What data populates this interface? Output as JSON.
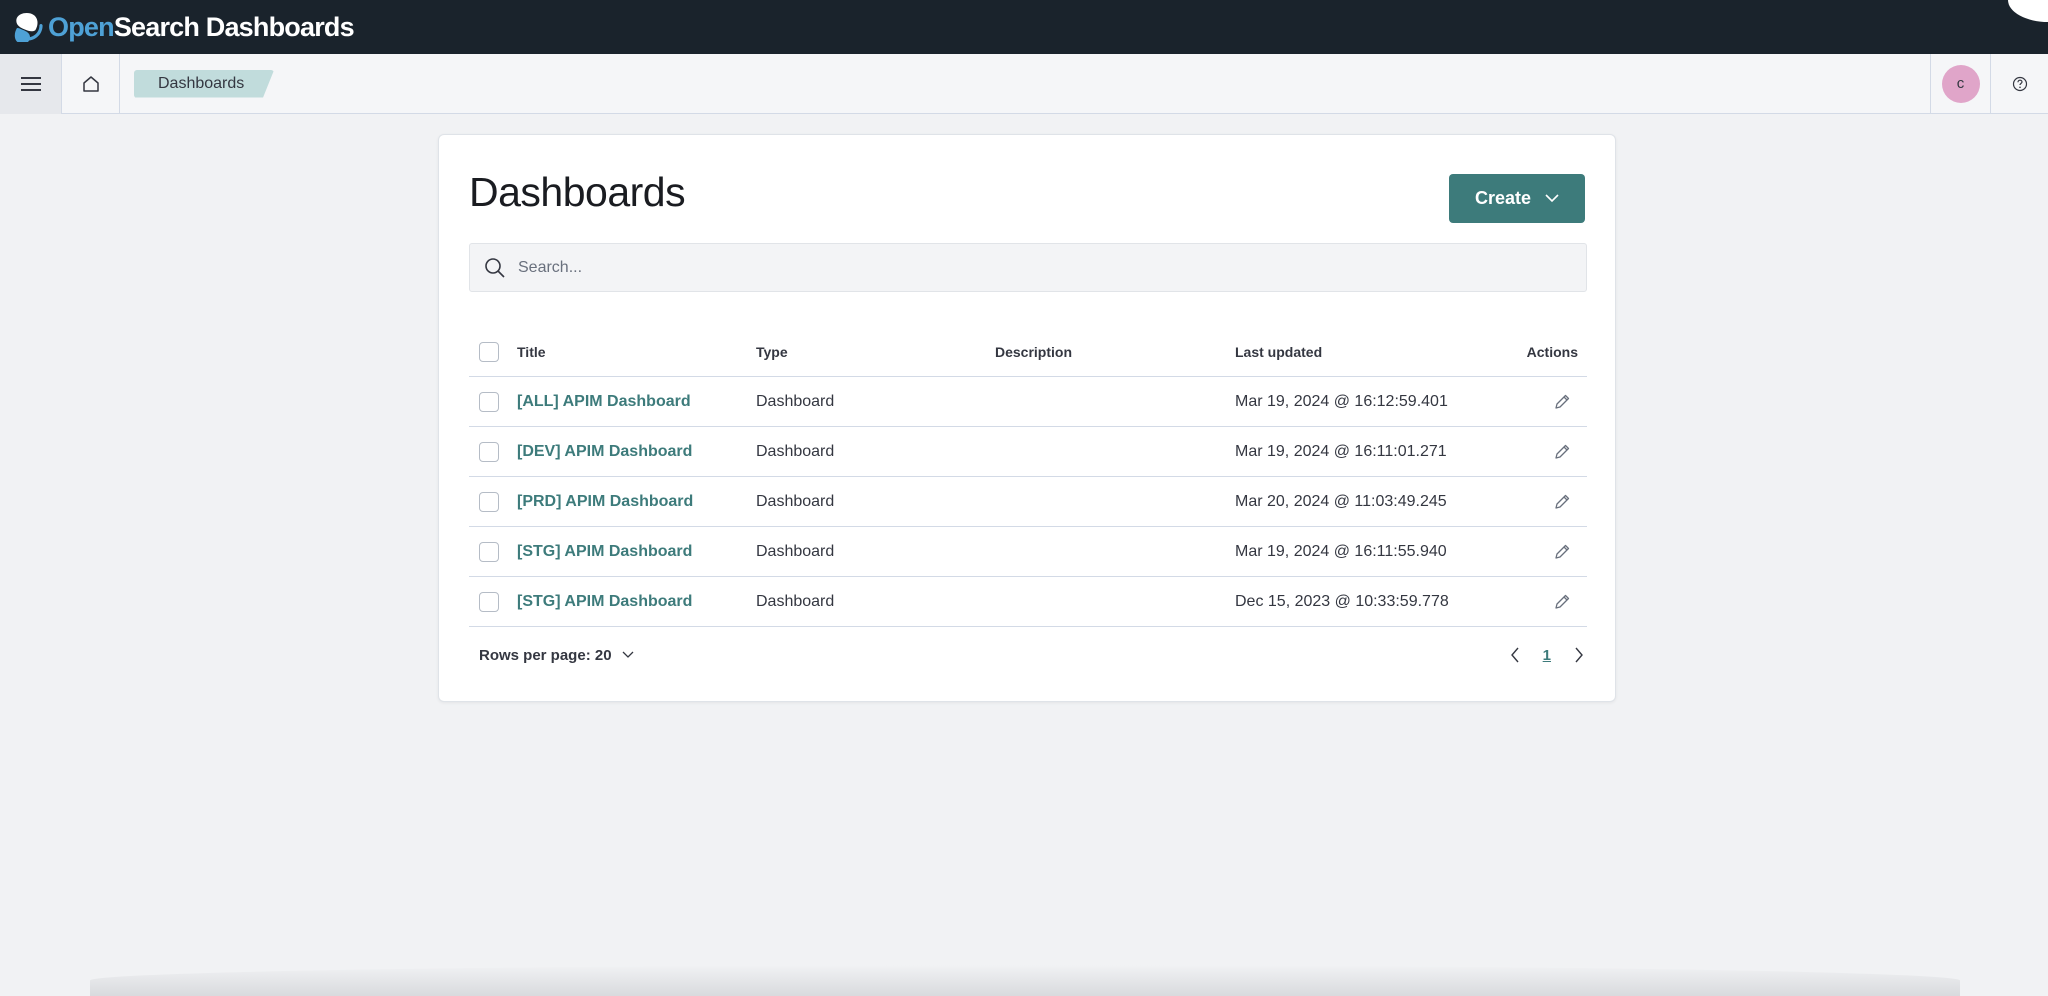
{
  "app": {
    "logo_open": "Open",
    "logo_rest": "Search Dashboards"
  },
  "nav": {
    "breadcrumb": "Dashboards",
    "avatar_initial": "c"
  },
  "page": {
    "title": "Dashboards",
    "create_label": "Create",
    "search_placeholder": "Search..."
  },
  "table": {
    "headers": {
      "title": "Title",
      "type": "Type",
      "description": "Description",
      "last_updated": "Last updated",
      "actions": "Actions"
    },
    "rows": [
      {
        "title": "[ALL] APIM Dashboard",
        "type": "Dashboard",
        "description": "",
        "last_updated": "Mar 19, 2024 @ 16:12:59.401"
      },
      {
        "title": "[DEV] APIM Dashboard",
        "type": "Dashboard",
        "description": "",
        "last_updated": "Mar 19, 2024 @ 16:11:01.271"
      },
      {
        "title": "[PRD] APIM Dashboard",
        "type": "Dashboard",
        "description": "",
        "last_updated": "Mar 20, 2024 @ 11:03:49.245"
      },
      {
        "title": "[STG] APIM Dashboard",
        "type": "Dashboard",
        "description": "",
        "last_updated": "Mar 19, 2024 @ 16:11:55.940"
      },
      {
        "title": "[STG] APIM Dashboard",
        "type": "Dashboard",
        "description": "",
        "last_updated": "Dec 15, 2023 @ 10:33:59.778"
      }
    ]
  },
  "pagination": {
    "rows_per_page": "Rows per page: 20",
    "current_page": "1"
  },
  "icons": {
    "menu": "hamburger-icon",
    "home": "home-icon",
    "help": "help-icon",
    "search": "search-icon",
    "edit": "pencil-icon",
    "prev": "chevron-left-icon",
    "next": "chevron-right-icon"
  },
  "colors": {
    "header_bg": "#1a232c",
    "accent": "#3d7b7b",
    "breadcrumb_bg": "#c1dcdc",
    "avatar_bg": "#e0a5c9",
    "logo_blue": "#4ea1d6"
  }
}
